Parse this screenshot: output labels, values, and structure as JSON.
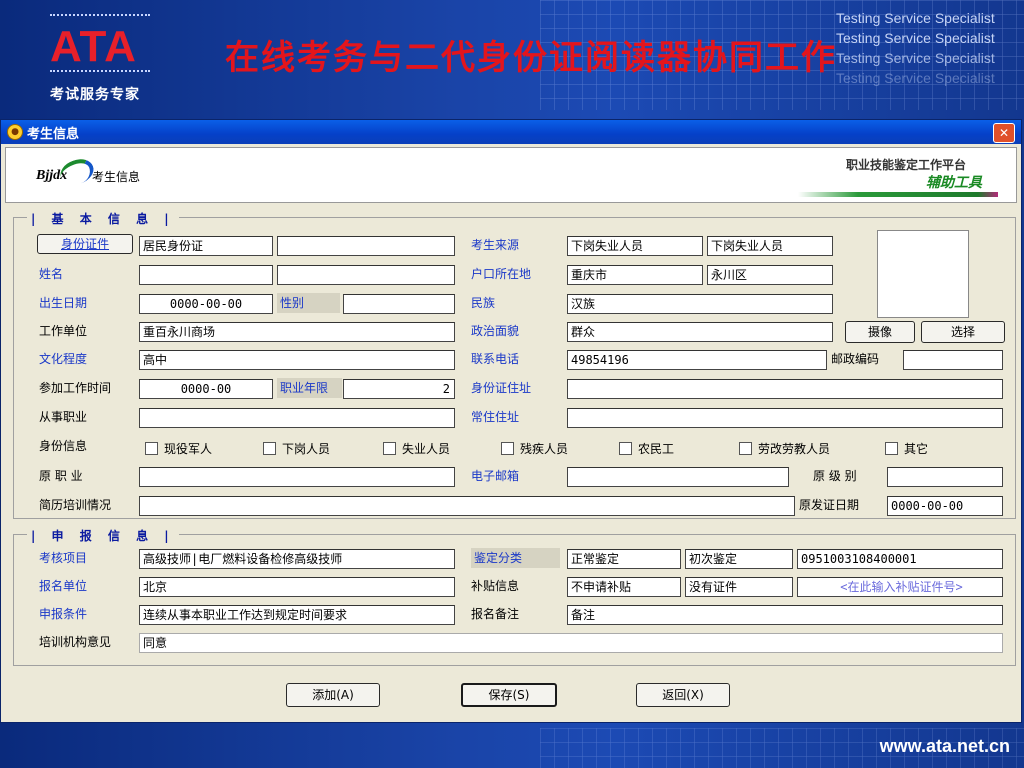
{
  "slide": {
    "logo_text": "ATA",
    "logo_sub": "考试服务专家",
    "title": "在线考务与二代身份证阅读器协同工作",
    "taglines": [
      "Testing  Service Specialist",
      "Testing  Service Specialist",
      "Testing  Service Specialist",
      "Testing  Service Specialist"
    ],
    "footer_url": "www.ata.net.cn"
  },
  "window": {
    "title": "考生信息",
    "close_glyph": "✕",
    "banner": {
      "brand": "Bjjdx",
      "module": "考生信息",
      "platform": "职业技能鉴定工作平台",
      "tool": "辅助工具"
    }
  },
  "basic": {
    "group_title": "| 基 本 信 息 |",
    "id_type_button": "身份证件",
    "id_type_value": "居民身份证",
    "id_number_value": "",
    "name_label": "姓名",
    "name_value": "",
    "name_pinyin_value": "",
    "birth_label": "出生日期",
    "birth_value": "0000-00-00",
    "gender_label": "性别",
    "gender_value": "",
    "work_unit_label": "工作单位",
    "work_unit_value": "重百永川商场",
    "education_label": "文化程度",
    "education_value": "高中",
    "work_start_label": "参加工作时间",
    "work_start_value": "0000-00",
    "work_years_label": "职业年限",
    "work_years_value": "2",
    "occupation_label": "从事职业",
    "occupation_value": "",
    "source_label": "考生来源",
    "source_value_1": "下岗失业人员",
    "source_value_2": "下岗失业人员",
    "hukou_label": "户口所在地",
    "hukou_city": "重庆市",
    "hukou_district": "永川区",
    "ethnicity_label": "民族",
    "ethnicity_value": "汉族",
    "politics_label": "政治面貌",
    "politics_value": "群众",
    "phone_label": "联系电话",
    "phone_value": "49854196",
    "postcode_label": "邮政编码",
    "postcode_value": "",
    "id_address_label": "身份证住址",
    "id_address_value": "",
    "residence_label": "常住住址",
    "residence_value": "",
    "photo_button": "摄像",
    "select_button": "选择",
    "identity_label": "身份信息",
    "identity_options": [
      "现役军人",
      "下岗人员",
      "失业人员",
      "残疾人员",
      "农民工",
      "劳改劳教人员",
      "其它"
    ],
    "orig_occupation_label": "原 职 业",
    "orig_occupation_value": "",
    "email_label": "电子邮箱",
    "email_value": "",
    "orig_level_label": "原 级 别",
    "orig_level_value": "",
    "resume_label": "简历培训情况",
    "resume_value": "",
    "orig_cert_date_label": "原发证日期",
    "orig_cert_date_value": "0000-00-00"
  },
  "apply": {
    "group_title": "| 申 报 信 息 |",
    "exam_item_label": "考核项目",
    "exam_item_value": "高级技师|电厂燃料设备检修高级技师",
    "reg_unit_label": "报名单位",
    "reg_unit_value": "北京",
    "condition_label": "申报条件",
    "condition_value": "连续从事本职业工作达到规定时间要求",
    "opinion_label": "培训机构意见",
    "opinion_value": "同意",
    "category_label": "鉴定分类",
    "category_value": "正常鉴定",
    "attempt_value": "初次鉴定",
    "code_value": "0951003108400001",
    "subsidy_label": "补贴信息",
    "subsidy_value": "不申请补贴",
    "cert_value": "没有证件",
    "subsidy_cert_placeholder": "<在此输入补贴证件号>",
    "remark_label": "报名备注",
    "remark_value": "备注"
  },
  "actions": {
    "add": "添加(A)",
    "save": "保存(S)",
    "back": "返回(X)"
  }
}
